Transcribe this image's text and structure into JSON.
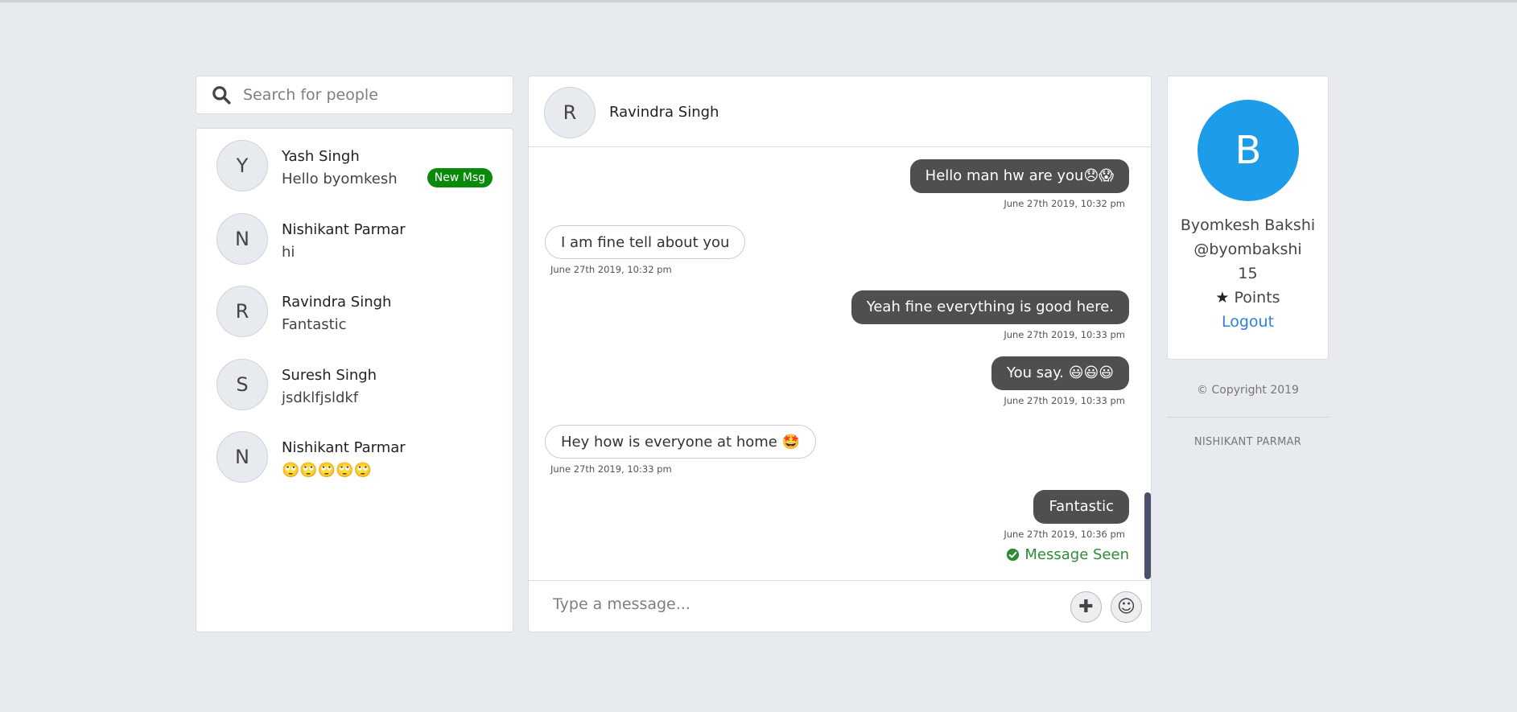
{
  "search": {
    "placeholder": "Search for people"
  },
  "contacts": [
    {
      "initial": "Y",
      "name": "Yash Singh",
      "last_message": "Hello byomkesh",
      "badge": "New Msg"
    },
    {
      "initial": "N",
      "name": "Nishikant Parmar",
      "last_message": "hi"
    },
    {
      "initial": "R",
      "name": "Ravindra Singh",
      "last_message": "Fantastic"
    },
    {
      "initial": "S",
      "name": "Suresh Singh",
      "last_message": "jsdklfjsldkf"
    },
    {
      "initial": "N",
      "name": "Nishikant Parmar",
      "last_message": "🙄🙄🙄🙄🙄"
    }
  ],
  "chat": {
    "header": {
      "initial": "R",
      "name": "Ravindra Singh"
    },
    "messages": [
      {
        "direction": "out",
        "text": "Hello man hw are you😞😱",
        "time": "June 27th 2019, 10:32 pm"
      },
      {
        "direction": "in",
        "text": "I am fine tell about you",
        "time": "June 27th 2019, 10:32 pm"
      },
      {
        "direction": "out",
        "text": "Yeah fine everything is good here.",
        "time": "June 27th 2019, 10:33 pm"
      },
      {
        "direction": "out",
        "text": "You say. 😃😃😃",
        "time": "June 27th 2019, 10:33 pm"
      },
      {
        "direction": "in",
        "text": "Hey how is everyone at home 🤩",
        "time": "June 27th 2019, 10:33 pm"
      },
      {
        "direction": "out",
        "text": "Fantastic",
        "time": "June 27th 2019, 10:36 pm"
      }
    ],
    "seen_status": "Message Seen",
    "composer": {
      "placeholder": "Type a message..."
    }
  },
  "profile": {
    "initial": "B",
    "name": "Byomkesh Bakshi",
    "username": "@byombakshi",
    "points_value": "15",
    "points_label": "Points",
    "logout_label": "Logout"
  },
  "footer": {
    "copyright": "© Copyright 2019",
    "author": "NISHIKANT PARMAR"
  },
  "colors": {
    "accent_blue": "#1d9ce9",
    "badge_green": "#0a8a0a",
    "outgoing_bubble": "#4f4f4f",
    "seen_green": "#2f8a36",
    "background": "#e7ebef"
  }
}
